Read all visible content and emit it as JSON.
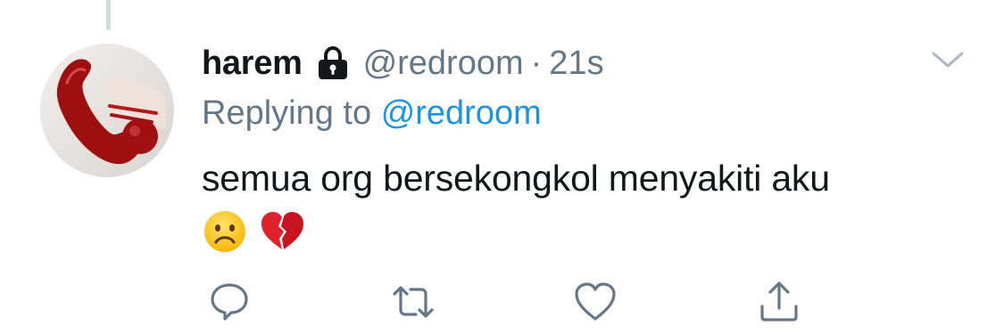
{
  "tweet": {
    "author_name": "harem",
    "author_handle": "@redroom",
    "separator": "·",
    "timestamp": "21s",
    "reply_prefix": "Replying to",
    "reply_to_handle": "@redroom",
    "text": "semua org bersekongkol menyakiti aku",
    "emojis": [
      "frowning-face",
      "broken-heart"
    ]
  },
  "icons": {
    "lock": "lock-icon",
    "caret": "chevron-down-icon",
    "reply": "reply-icon",
    "retweet": "retweet-icon",
    "like": "heart-icon",
    "share": "share-icon"
  },
  "colors": {
    "text_primary": "#14171a",
    "text_secondary": "#657786",
    "link": "#1b95e0",
    "thread_line": "#cfd9de",
    "action_icon": "#657786"
  }
}
